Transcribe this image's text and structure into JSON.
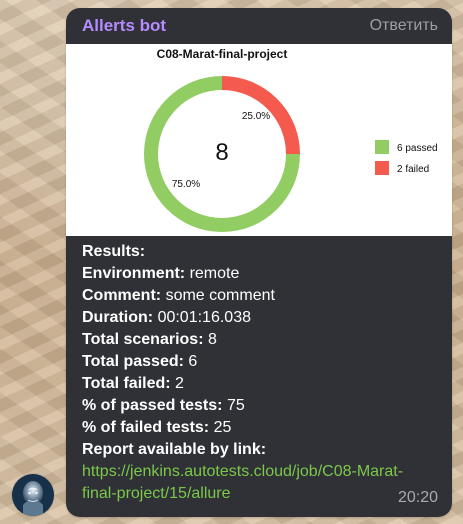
{
  "bubble": {
    "sender": "Allerts bot",
    "reply_label": "Ответить",
    "time": "20:20"
  },
  "chart_data": {
    "type": "pie",
    "title": "C08-Marat-final-project",
    "center_value": "8",
    "categories": [
      "6 passed",
      "2 failed"
    ],
    "values": [
      6,
      2
    ],
    "percent_labels": [
      "75.0%",
      "25.0%"
    ],
    "colors": [
      "#91cd63",
      "#f55a4e"
    ],
    "legend_position": "right"
  },
  "message": {
    "results_heading": "Results:",
    "environment_label": "Environment:",
    "environment_value": "remote",
    "comment_label": "Comment:",
    "comment_value": "some comment",
    "duration_label": "Duration:",
    "duration_value": "00:01:16.038",
    "total_scenarios_label": "Total scenarios:",
    "total_scenarios_value": "8",
    "total_passed_label": "Total passed:",
    "total_passed_value": "6",
    "total_failed_label": "Total failed:",
    "total_failed_value": "2",
    "passed_percent_label": "% of passed tests:",
    "passed_percent_value": "75",
    "failed_percent_label": "% of failed tests:",
    "failed_percent_value": "25",
    "report_label": "Report available by link:",
    "report_link_line1": "https://jenkins.autotests.cloud/job/C08-Marat-",
    "report_link_line2": "final-project/15/allure"
  }
}
